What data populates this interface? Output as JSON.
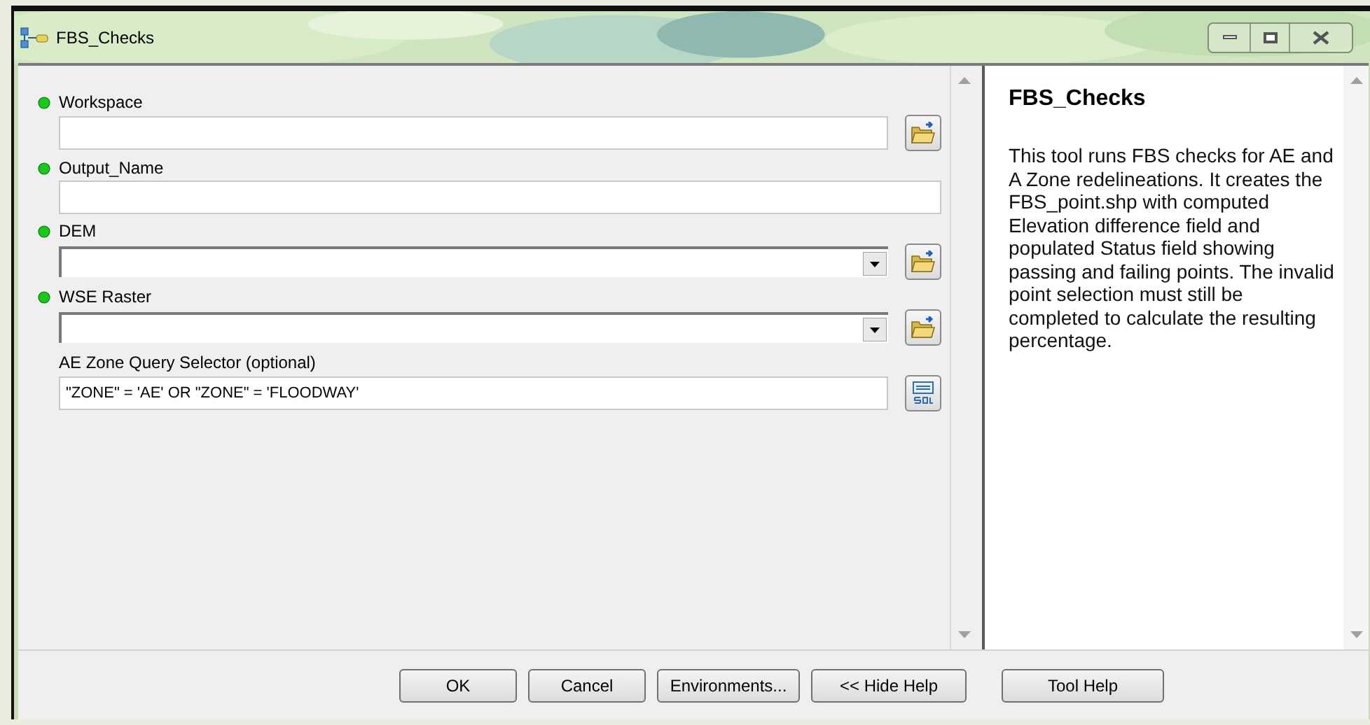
{
  "window": {
    "title": "FBS_Checks"
  },
  "parameters": [
    {
      "label": "Workspace",
      "required": true,
      "kind": "text",
      "browse": true
    },
    {
      "label": "Output_Name",
      "required": true,
      "kind": "text"
    },
    {
      "label": "DEM",
      "required": true,
      "kind": "dropdown",
      "browse": true
    },
    {
      "label": "WSE Raster",
      "required": true,
      "kind": "dropdown",
      "browse": true
    },
    {
      "label": "AE Zone Query Selector (optional)",
      "required": false,
      "kind": "text",
      "value": "\"ZONE\" = 'AE' OR \"ZONE\" = 'FLOODWAY'",
      "sql": true
    }
  ],
  "help": {
    "title": "FBS_Checks",
    "body": "This tool runs FBS checks for AE and A Zone redelineations. It creates the FBS_point.shp with computed Elevation difference field and populated Status field showing passing and failing points. The invalid point selection must still be completed to calculate the resulting percentage."
  },
  "buttons": [
    "OK",
    "Cancel",
    "Environments...",
    "<< Hide Help",
    "Tool Help"
  ]
}
